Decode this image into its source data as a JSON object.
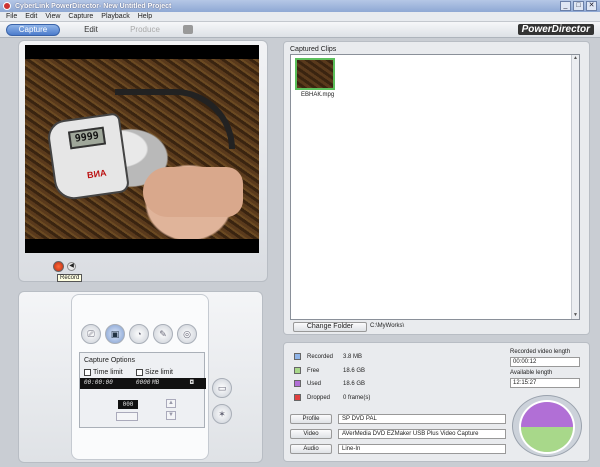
{
  "window": {
    "title": "CyberLink PowerDirector- New Untitled Project",
    "min": "_",
    "max": "□",
    "close": "✕"
  },
  "menu": [
    "File",
    "Edit",
    "View",
    "Capture",
    "Playback",
    "Help"
  ],
  "modes": [
    {
      "label": "Capture",
      "state": "active"
    },
    {
      "label": "Edit",
      "state": "normal"
    },
    {
      "label": "Produce",
      "state": "disabled"
    }
  ],
  "brand": "PowerDirector",
  "preview": {
    "lcd_reading": "9999",
    "device_text": "ВИА",
    "record_tooltip": "Record",
    "play_glyph": "◀"
  },
  "capture_options": {
    "title": "Capture Options",
    "time_limit_label": "Time limit",
    "size_limit_label": "Size limit",
    "time_value": "00:00:00",
    "size_value": "0000",
    "size_unit": "MB",
    "digit_value": "000"
  },
  "clips": {
    "label": "Captured Clips",
    "items": [
      {
        "name": "ЕВНАК.mpg"
      }
    ],
    "change_folder_label": "Change Folder",
    "folder_path": "C:\\MyWorks\\"
  },
  "stats": [
    {
      "label": "Recorded",
      "value": "3.8  MB",
      "color": "#8fb4e8"
    },
    {
      "label": "Free",
      "value": "18.6  GB",
      "color": "#a8d88a"
    },
    {
      "label": "Used",
      "value": "18.6  GB",
      "color": "#b16fd6"
    },
    {
      "label": "Dropped",
      "value": "0 frame(s)",
      "color": "#e04040"
    }
  ],
  "recorded_length": {
    "label": "Recorded video length",
    "value": "00:00:12"
  },
  "available_length": {
    "label": "Available length",
    "value": "12:15:27"
  },
  "devices": [
    {
      "button": "Profile",
      "value": "SP DVD PAL"
    },
    {
      "button": "Video",
      "value": "AVerMedia DVD EZMaker USB Plus Video Capture"
    },
    {
      "button": "Audio",
      "value": "Line-In"
    }
  ],
  "disk_usage": {
    "used_fraction": 0.5,
    "free_fraction": 0.5
  }
}
